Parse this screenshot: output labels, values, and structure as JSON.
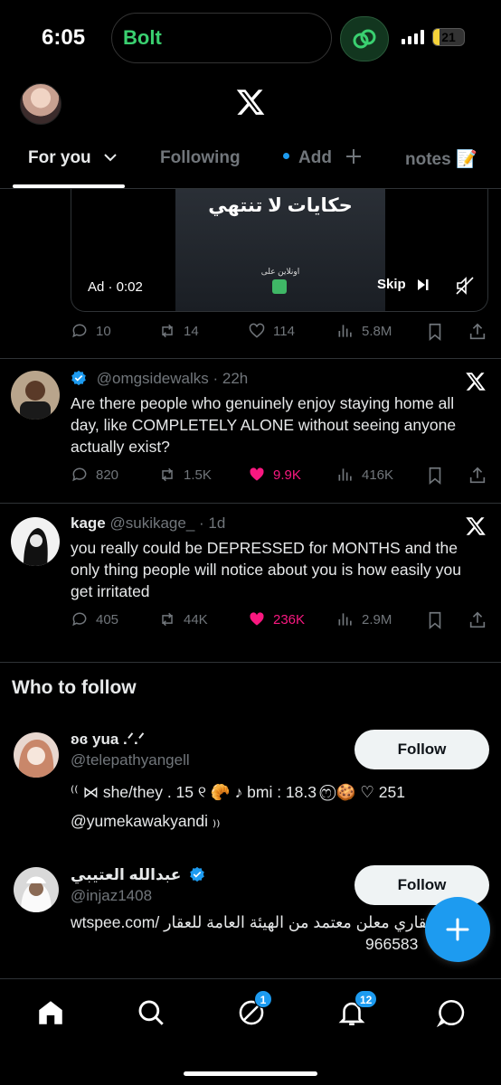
{
  "status_bar": {
    "time": "6:05",
    "activity_app": "Bolt",
    "battery_level": "21",
    "colors": {
      "bolt_green": "#3ad070",
      "battery": "#f5d33a"
    }
  },
  "header": {
    "tabs": [
      {
        "label": "For you",
        "active": true
      },
      {
        "label": "Following",
        "active": false
      },
      {
        "label": "Add",
        "active": false
      },
      {
        "label": "notes 📝",
        "active": false
      }
    ]
  },
  "ad": {
    "title": "حكايات لا تنتهي",
    "subtitle": "اونلاين على",
    "label": "Ad · 0:02",
    "skip": "Skip",
    "stats": {
      "replies": "10",
      "reposts": "14",
      "likes": "114",
      "views": "5.8M"
    }
  },
  "tweets": [
    {
      "name": "",
      "handle": "@omgsidewalks",
      "time": "22h",
      "verified": true,
      "text": "Are there people who genuinely enjoy staying home all day, like COMPLETELY ALONE without seeing anyone actually exist?",
      "stats": {
        "replies": "820",
        "reposts": "1.5K",
        "likes": "9.9K",
        "views": "416K",
        "liked": true
      }
    },
    {
      "name": "kage",
      "handle": "@sukikage_",
      "time": "1d",
      "verified": false,
      "text": "you really could be DEPRESSED for MONTHS and the only thing people will notice about you is how easily you get irritated",
      "stats": {
        "replies": "405",
        "reposts": "44K",
        "likes": "236K",
        "views": "2.9M",
        "liked": true
      }
    }
  ],
  "who_to_follow": {
    "title": "Who to follow",
    "accounts": [
      {
        "name": "ʚɞ yua .ᐟ.ᐟ",
        "handle": "@telepathyangell",
        "bio_line1": "⁽⁽ ⋈ she/they . 15 ୧ 🥐 ♪ bmi : 18.3 ෆ⃝ 🍪 ♡ 251",
        "bio_line2": "@yumekawakyandi ₎₎",
        "follow_label": "Follow"
      },
      {
        "name": "عبدالله العتيبي",
        "handle": "@injaz1408",
        "verified": true,
        "bio_line1": "wtspee.com/ عقاري معلن معتمد من الهيئة العامة للعقار",
        "bio_line2": "966583",
        "follow_label": "Follow"
      }
    ]
  },
  "bottom_nav": {
    "items": [
      "home",
      "search",
      "grok",
      "notifications",
      "messages"
    ],
    "grok_badge": "1",
    "notifications_badge": "12"
  },
  "colors": {
    "accent": "#1d9bf0",
    "like": "#f91880",
    "muted": "#71767b",
    "text": "#e7e9ea"
  }
}
